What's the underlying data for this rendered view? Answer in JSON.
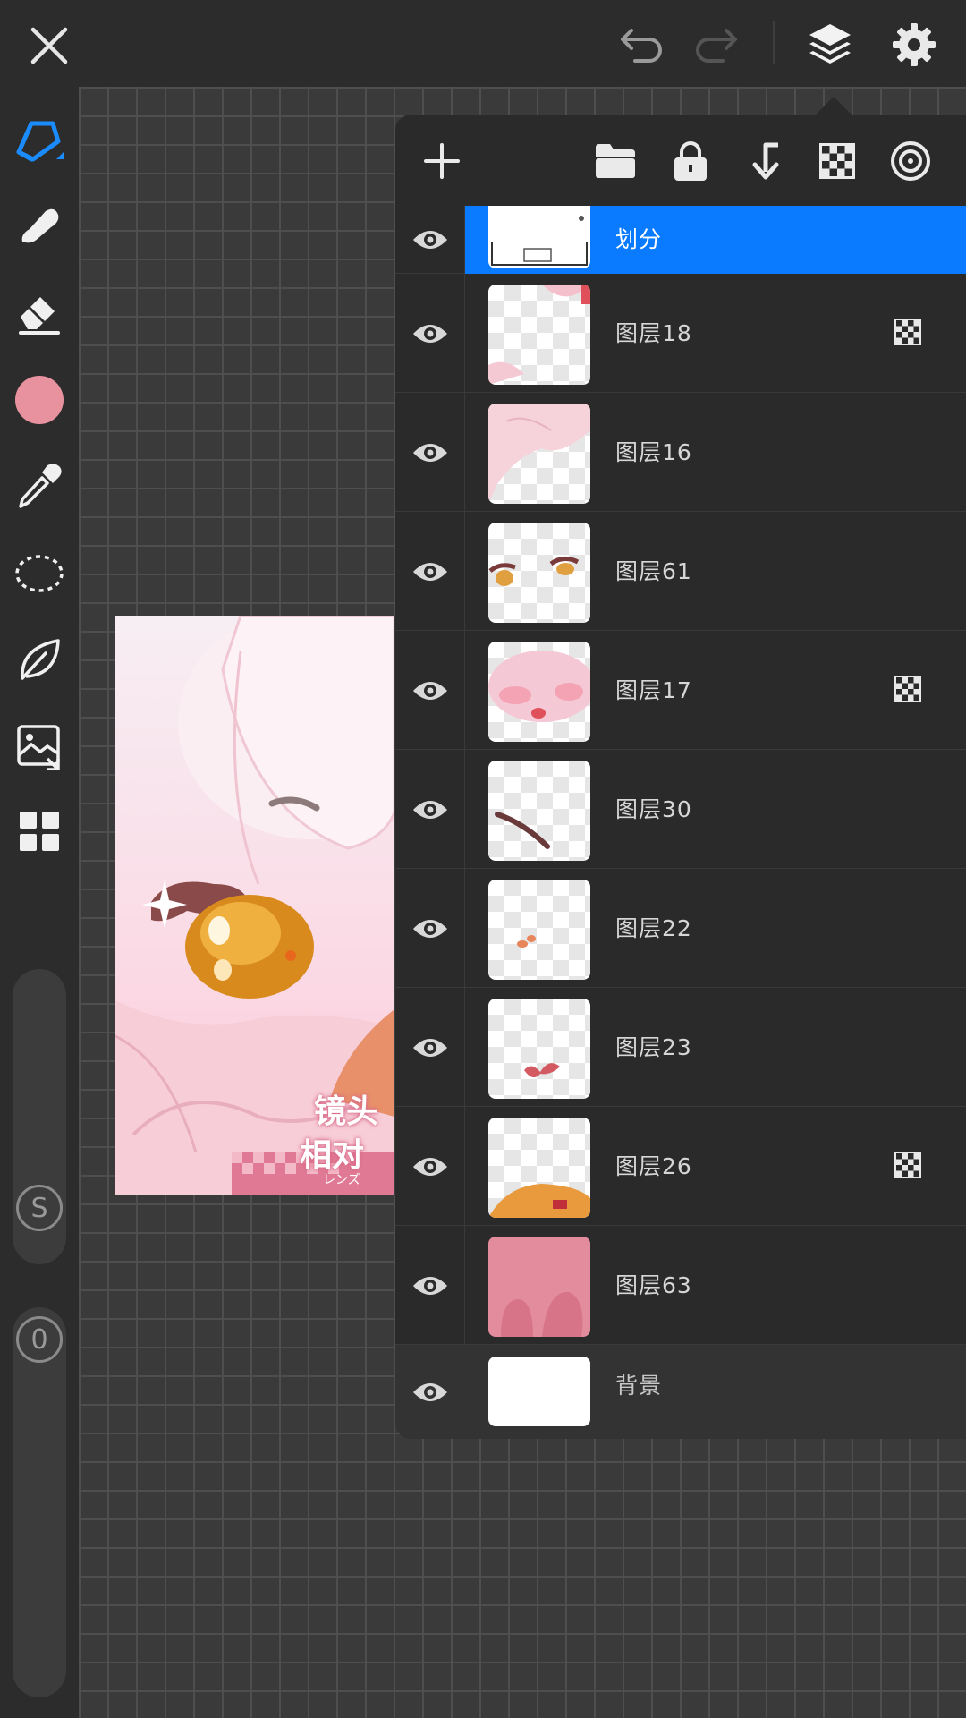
{
  "topbar": {
    "close_icon": "close-icon",
    "undo_icon": "undo-icon",
    "redo_icon": "redo-icon",
    "layers_icon": "layers-icon",
    "settings_icon": "gear-icon"
  },
  "sidebar": {
    "tools": [
      "pen",
      "smudge",
      "eraser",
      "color",
      "eyedropper",
      "lasso",
      "leaf",
      "image-import",
      "grid-menu"
    ],
    "current_color": "#e8929f",
    "size_knob_label": "S",
    "opacity_knob_label": "0"
  },
  "layers": {
    "selected_color": "#0a7aff",
    "items": [
      {
        "name": "划分",
        "selected": true,
        "alpha_lock": false
      },
      {
        "name": "图层18",
        "selected": false,
        "alpha_lock": true
      },
      {
        "name": "图层16",
        "selected": false,
        "alpha_lock": false
      },
      {
        "name": "图层61",
        "selected": false,
        "alpha_lock": false
      },
      {
        "name": "图层17",
        "selected": false,
        "alpha_lock": true
      },
      {
        "name": "图层30",
        "selected": false,
        "alpha_lock": false
      },
      {
        "name": "图层22",
        "selected": false,
        "alpha_lock": false
      },
      {
        "name": "图层23",
        "selected": false,
        "alpha_lock": false
      },
      {
        "name": "图层26",
        "selected": false,
        "alpha_lock": true
      },
      {
        "name": "图层63",
        "selected": false,
        "alpha_lock": false
      },
      {
        "name": "背景",
        "selected": false,
        "alpha_lock": false
      }
    ]
  },
  "artwork": {
    "text_1": "镜头",
    "text_2": "相对",
    "text_3": "レンズ"
  }
}
